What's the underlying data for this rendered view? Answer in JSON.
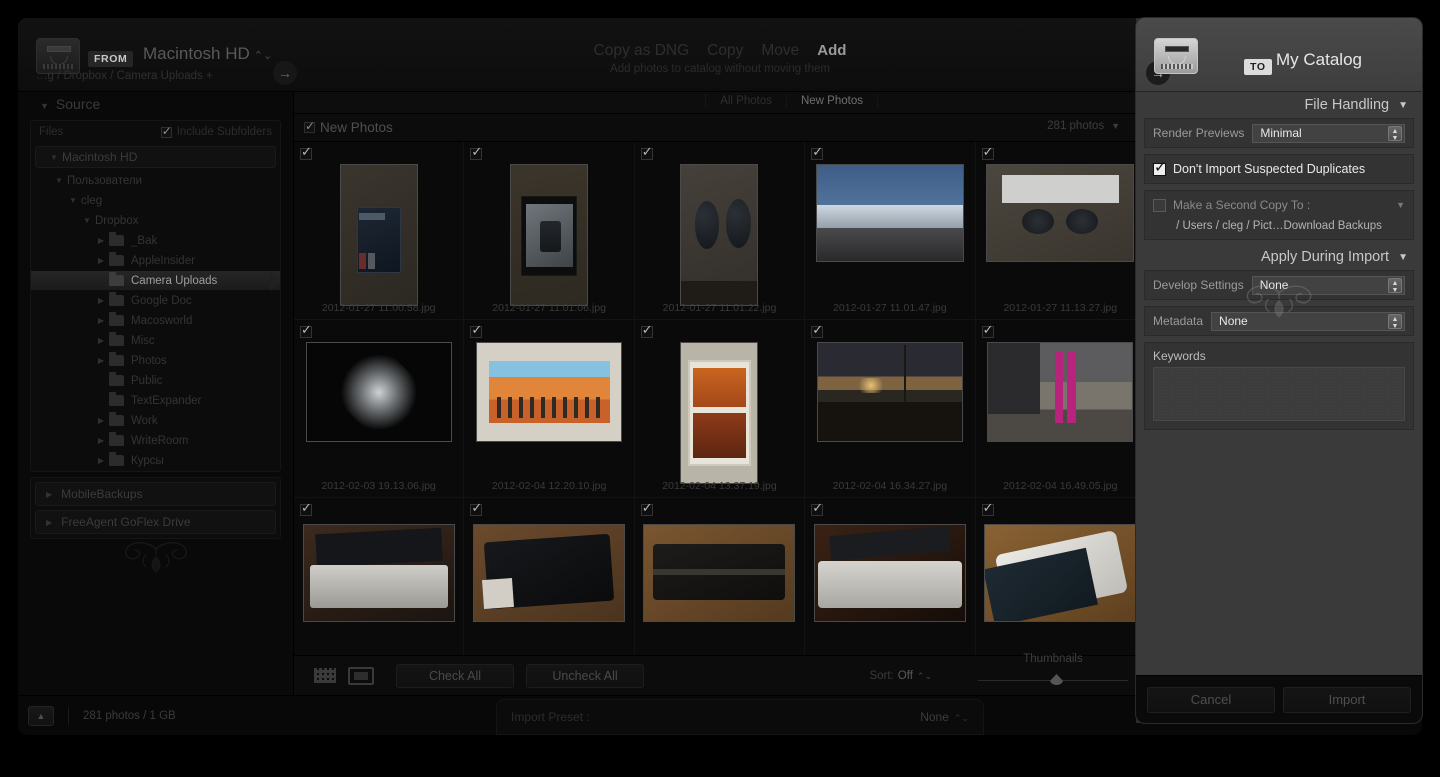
{
  "header": {
    "from_badge": "FROM",
    "source_name": "Macintosh HD",
    "source_caret": "⌃⌄",
    "source_path": "…g / Dropbox / Camera Uploads +",
    "arrow_glyph": "→",
    "modes": [
      {
        "label": "Copy as DNG",
        "active": false
      },
      {
        "label": "Copy",
        "active": false
      },
      {
        "label": "Move",
        "active": false
      },
      {
        "label": "Add",
        "active": true
      }
    ],
    "mode_subtitle": "Add photos to catalog without moving them",
    "to_badge": "TO",
    "catalog_name": "My Catalog"
  },
  "source_panel": {
    "title": "Source",
    "triangle": "▼",
    "files_label": "Files",
    "include_subfolders_label": "Include Subfolders",
    "include_subfolders_checked": true,
    "volume": "Macintosh HD",
    "tree": [
      {
        "label": "Пользователи",
        "indent": 1,
        "disclosure": "open",
        "folder": false,
        "selected": false
      },
      {
        "label": "cleg",
        "indent": 2,
        "disclosure": "open",
        "folder": false,
        "selected": false
      },
      {
        "label": "Dropbox",
        "indent": 3,
        "disclosure": "open",
        "folder": false,
        "selected": false
      },
      {
        "label": "_Bak",
        "indent": 4,
        "disclosure": "closed",
        "folder": true,
        "selected": false
      },
      {
        "label": "AppleInsider",
        "indent": 4,
        "disclosure": "closed",
        "folder": true,
        "selected": false
      },
      {
        "label": "Camera Uploads",
        "indent": 4,
        "disclosure": "none",
        "folder": true,
        "selected": true
      },
      {
        "label": "Google Doc",
        "indent": 4,
        "disclosure": "closed",
        "folder": true,
        "selected": false
      },
      {
        "label": "Macosworld",
        "indent": 4,
        "disclosure": "closed",
        "folder": true,
        "selected": false
      },
      {
        "label": "Misc",
        "indent": 4,
        "disclosure": "closed",
        "folder": true,
        "selected": false
      },
      {
        "label": "Photos",
        "indent": 4,
        "disclosure": "closed",
        "folder": true,
        "selected": false
      },
      {
        "label": "Public",
        "indent": 4,
        "disclosure": "none",
        "folder": true,
        "selected": false
      },
      {
        "label": "TextExpander",
        "indent": 4,
        "disclosure": "none",
        "folder": true,
        "selected": false
      },
      {
        "label": "Work",
        "indent": 4,
        "disclosure": "closed",
        "folder": true,
        "selected": false
      },
      {
        "label": "WriteRoom",
        "indent": 4,
        "disclosure": "closed",
        "folder": true,
        "selected": false
      },
      {
        "label": "Курсы",
        "indent": 4,
        "disclosure": "closed",
        "folder": true,
        "selected": false
      }
    ],
    "drives": [
      {
        "label": "MobileBackups"
      },
      {
        "label": "FreeAgent GoFlex Drive"
      }
    ]
  },
  "grid": {
    "tabs": [
      {
        "label": "All Photos",
        "active": false
      },
      {
        "label": "New Photos",
        "active": true
      }
    ],
    "header_title": "New Photos",
    "header_checked": true,
    "photo_count_label": "281 photos",
    "count_caret": "▼",
    "cells": [
      {
        "filename": "2012-01-27 11.00.58.jpg",
        "checked": true,
        "kind": "box-on-table"
      },
      {
        "filename": "2012-01-27 11.01.06.jpg",
        "checked": true,
        "kind": "lens-in-case"
      },
      {
        "filename": "2012-01-27 11.01.22.jpg",
        "checked": true,
        "kind": "two-caps"
      },
      {
        "filename": "2012-01-27 11.01.47.jpg",
        "checked": true,
        "kind": "blue-sky-edge"
      },
      {
        "filename": "2012-01-27 11.13.27.jpg",
        "checked": true,
        "kind": "camera-parts"
      },
      {
        "filename": "2012-02-03 19.13.06.jpg",
        "checked": true,
        "kind": "dark-light"
      },
      {
        "filename": "2012-02-04 12.20.10.jpg",
        "checked": true,
        "kind": "orange-mural"
      },
      {
        "filename": "2012-02-04 13.37.19.jpg",
        "checked": true,
        "kind": "framed-art"
      },
      {
        "filename": "2012-02-04 16.34.27.jpg",
        "checked": true,
        "kind": "sunset-street"
      },
      {
        "filename": "2012-02-04 16.49.05.jpg",
        "checked": true,
        "kind": "pink-poles"
      },
      {
        "filename": "",
        "checked": true,
        "kind": "laptop-dark"
      },
      {
        "filename": "",
        "checked": true,
        "kind": "black-slab"
      },
      {
        "filename": "",
        "checked": true,
        "kind": "folio-wood"
      },
      {
        "filename": "",
        "checked": true,
        "kind": "white-cloth"
      },
      {
        "filename": "",
        "checked": true,
        "kind": "tablet-wood"
      }
    ]
  },
  "toolbar": {
    "grid_view_icon": "grid-view-icon",
    "loupe_view_icon": "loupe-view-icon",
    "check_all_label": "Check All",
    "uncheck_all_label": "Uncheck All",
    "sort_label": "Sort:",
    "sort_value": "Off",
    "sort_caret": "⌃⌄",
    "thumbnails_label": "Thumbnails",
    "thumbnails_value": 48
  },
  "bottom": {
    "collapse_glyph": "▲",
    "photos_size": "281 photos / 1 GB",
    "import_preset_label": "Import Preset :",
    "import_preset_value": "None",
    "preset_caret": "⌃⌄"
  },
  "file_handling": {
    "title": "File Handling",
    "triangle": "▼",
    "render_previews_label": "Render Previews",
    "render_previews_value": "Minimal",
    "dont_import_duplicates_label": "Don't Import Suspected Duplicates",
    "dont_import_duplicates_checked": true,
    "second_copy_label": "Make a Second Copy To :",
    "second_copy_checked": false,
    "second_copy_path": "/ Users / cleg / Pict…Download Backups",
    "second_copy_caret": "▼"
  },
  "apply_during_import": {
    "title": "Apply During Import",
    "triangle": "▼",
    "develop_settings_label": "Develop Settings",
    "develop_settings_value": "None",
    "metadata_label": "Metadata",
    "metadata_value": "None",
    "keywords_label": "Keywords",
    "keywords_value": ""
  },
  "actions": {
    "cancel_label": "Cancel",
    "import_label": "Import"
  },
  "colors": {
    "panel_bg": "#3a3a3a",
    "dialog_bg": "#0a0a0a",
    "accent_text": "#e8e8e8",
    "selected_row": "#262626"
  }
}
